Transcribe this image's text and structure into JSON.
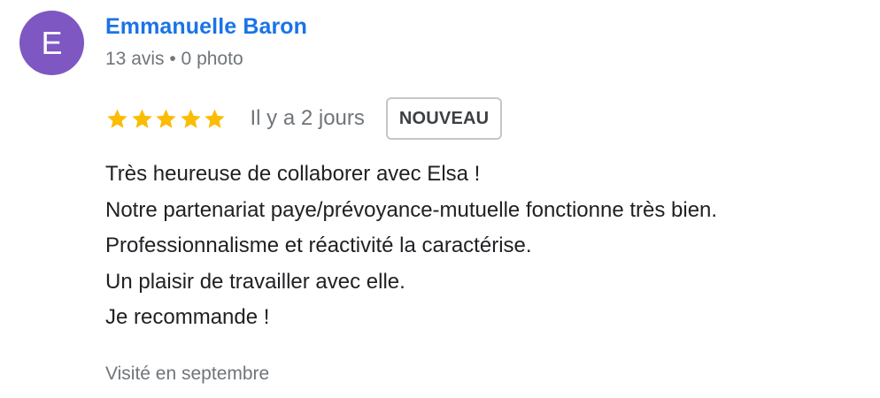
{
  "author": {
    "initial": "E",
    "name": "Emmanuelle Baron",
    "meta": "13 avis • 0 photo",
    "avatar_color": "#7e57c2"
  },
  "rating": {
    "stars": 5,
    "max_stars": 5,
    "star_color": "#fbbc04",
    "icon": "star-icon",
    "time_ago": "Il y a 2 jours",
    "badge": "NOUVEAU"
  },
  "review": {
    "lines": [
      "Très heureuse de collaborer avec Elsa !",
      "Notre partenariat paye/prévoyance-mutuelle fonctionne très bien.",
      "Professionnalisme et réactivité la caractérise.",
      "Un plaisir de travailler avec elle.",
      "Je recommande !"
    ]
  },
  "visit": "Visité en septembre",
  "colors": {
    "name_link": "#1a73e8",
    "secondary_text": "#70757a",
    "body_text": "#202124"
  }
}
